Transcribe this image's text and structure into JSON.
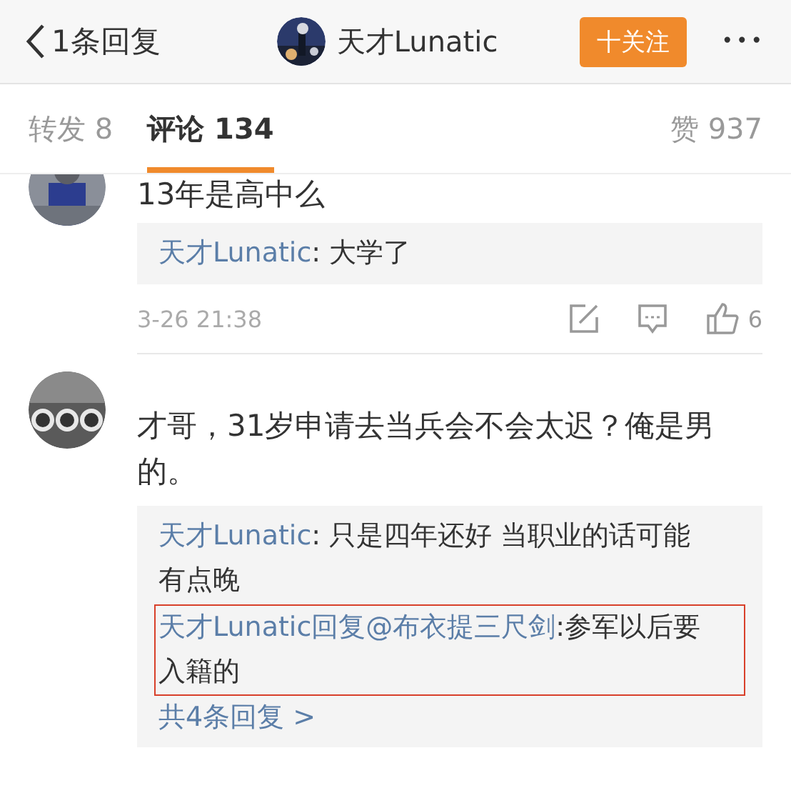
{
  "header": {
    "back_label": "1条回复",
    "user_name": "天才Lunatic",
    "follow_button": "十关注",
    "more": "•••"
  },
  "tabs": [
    {
      "label": "转发 8",
      "selected": false
    },
    {
      "label": "评论 134",
      "selected": true
    }
  ],
  "likes_total": "赞 937",
  "comments": [
    {
      "text": "13年是高中么",
      "replies": [
        {
          "highlighted": false,
          "parts": [
            {
              "kind": "user",
              "text": "天才Lunatic"
            },
            {
              "kind": "text",
              "text": ": 大学了"
            }
          ]
        }
      ],
      "time": "3-26 21:38",
      "like_count": "6"
    },
    {
      "text": "才哥，31岁申请去当兵会不会太迟？俺是男的。",
      "replies": [
        {
          "highlighted": false,
          "parts": [
            {
              "kind": "user",
              "text": "天才Lunatic"
            },
            {
              "kind": "text",
              "text": ": 只是四年还好 当职业的话可能有点晚"
            }
          ]
        },
        {
          "highlighted": true,
          "parts": [
            {
              "kind": "user",
              "text": "天才Lunatic"
            },
            {
              "kind": "user",
              "text": "回复@布衣提三尺剑"
            },
            {
              "kind": "text",
              "text": ":参军以后要入籍的"
            }
          ]
        }
      ],
      "more_replies": "共4条回复 >"
    }
  ]
}
